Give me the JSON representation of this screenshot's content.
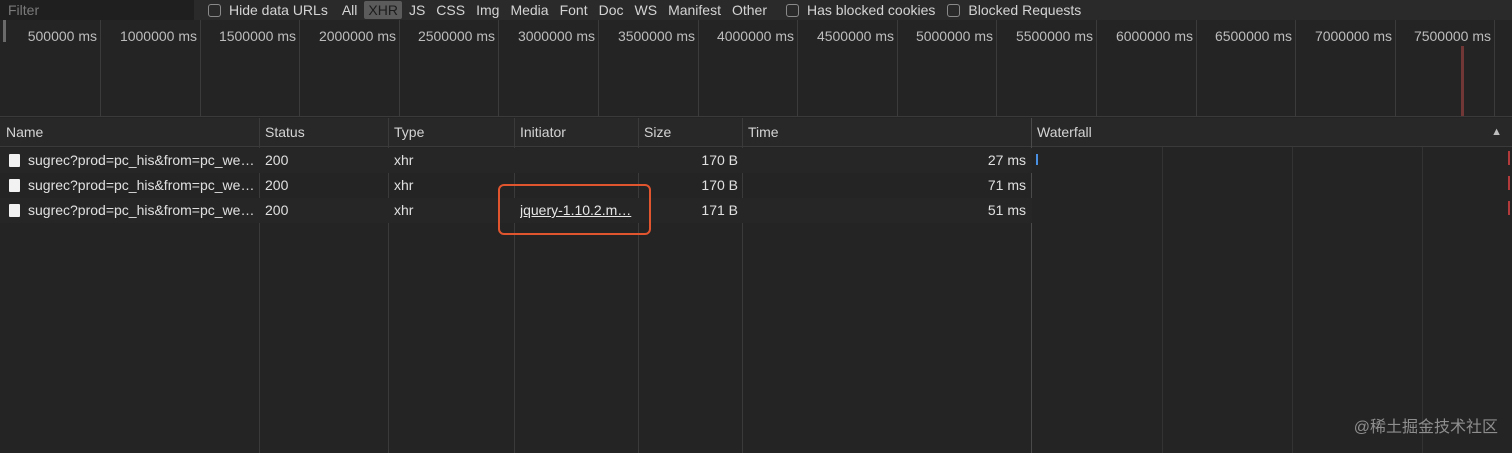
{
  "toolbar": {
    "filter_placeholder": "Filter",
    "hide_data_urls": "Hide data URLs",
    "types": [
      "All",
      "XHR",
      "JS",
      "CSS",
      "Img",
      "Media",
      "Font",
      "Doc",
      "WS",
      "Manifest",
      "Other"
    ],
    "active_type": "XHR",
    "has_blocked_cookies": "Has blocked cookies",
    "blocked_requests": "Blocked Requests"
  },
  "overview": {
    "labels": [
      "500000 ms",
      "1000000 ms",
      "1500000 ms",
      "2000000 ms",
      "2500000 ms",
      "3000000 ms",
      "3500000 ms",
      "4000000 ms",
      "4500000 ms",
      "5000000 ms",
      "5500000 ms",
      "6000000 ms",
      "6500000 ms",
      "7000000 ms",
      "7500000 ms"
    ]
  },
  "table": {
    "headers": {
      "name": "Name",
      "status": "Status",
      "type": "Type",
      "initiator": "Initiator",
      "size": "Size",
      "time": "Time",
      "waterfall": "Waterfall"
    },
    "rows": [
      {
        "name": "sugrec?prod=pc_his&from=pc_we…",
        "status": "200",
        "type": "xhr",
        "initiator": "",
        "size": "170 B",
        "time": "27 ms"
      },
      {
        "name": "sugrec?prod=pc_his&from=pc_we…",
        "status": "200",
        "type": "xhr",
        "initiator": "",
        "size": "170 B",
        "time": "71 ms"
      },
      {
        "name": "sugrec?prod=pc_his&from=pc_we…",
        "status": "200",
        "type": "xhr",
        "initiator": "jquery-1.10.2.m…",
        "size": "171 B",
        "time": "51 ms"
      }
    ]
  },
  "watermark": "@稀土掘金技术社区",
  "colors": {
    "highlight": "#e0542e",
    "waterfall_bar": "#4a90e2"
  }
}
